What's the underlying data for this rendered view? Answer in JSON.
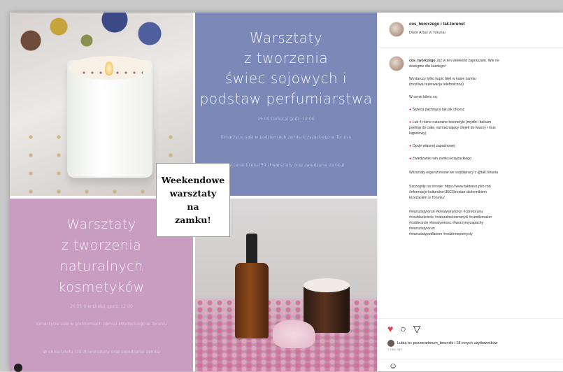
{
  "post": {
    "username": "cos_tworczego i tak.torunut",
    "location": "Dwór Artus w Toruniu",
    "caption_lines": [
      {
        "user": "cos_tworczego",
        "text": "Już w ten weekend zapraszam. Wie ne"
      },
      {
        "text": "dostępne dla każdego!"
      },
      {
        "text": "Wystarczy tylko kupić bilet w kasie zamku"
      },
      {
        "text": "(możliwa rezerwacja telefoniczna)"
      },
      {
        "text": "W cenie biletu są:"
      },
      {
        "bullet": true,
        "text": "Świeca pachnąca tak jak chcesz"
      },
      {
        "bullet": true,
        "text": "Lub 4 różne naturalne kosmetyki (mydło i balsam"
      },
      {
        "text": "peeling do ciała, wzmacniający olejek do twarzy i mus"
      },
      {
        "text": "kąpielowy)"
      },
      {
        "bullet": true,
        "text": "Opcje własnej zapachowej"
      },
      {
        "bullet": true,
        "text": "Zwiedzanie ruin zamku krzyżackiego"
      },
      {
        "text": "Warsztaty organizowane we współpracy z @tak.torunia"
      },
      {
        "text": "Szczegóły na stronie: https://www.taktorun.pl/o-rod"
      },
      {
        "text": "/informacje-kulturalne-35C3/zostan-alchemikiem"
      },
      {
        "text": "krzyżackim w Toruniu/"
      },
      {
        "text": "#warsztatytorun #kreatywnytorun #coretorunu"
      },
      {
        "text": "#cosblackcircle #naturalnekosmetyki #candlemaker"
      },
      {
        "text": "#coblecircle #kreatywnosc #tworzymyzapachy"
      },
      {
        "text": "#warsztatytorun"
      },
      {
        "text": "#warsztatypodlasem #rodzinnepomysly"
      }
    ],
    "liked_by": "Lubią to: pozzorariorum_torunski i 18 innych użytkowników",
    "date": "1 day ago"
  },
  "image": {
    "top_right": {
      "title_lines": [
        "Warsztaty",
        "z tworzenia",
        "świec sojowych i",
        "podstaw perfumiarstwa"
      ],
      "date": "25.05 (sobota) godz. 12:00",
      "place": "Kimarzycie sala w podziemiach zamku krzyżackiego w Toruniu",
      "price": "W cenie biletu (39 zł warsztaty oraz zwiedzanie zamku)"
    },
    "bottom_left": {
      "title_lines": [
        "Warsztaty",
        "z tworzenia",
        "naturalnych",
        "kosmetyków"
      ],
      "date": "26.05 (niedziela), godz. 12:00",
      "place": "Kimarzycie sala w podziemiach zamku krzyżackiego w Toruniu",
      "price": "W cenie biletu (39 zł) warsztaty oraz zwiedzanie zamku"
    },
    "badge_text": "Weekendowe\nwarsztaty\nna\nzamku!"
  },
  "icons": {
    "like": "heart-icon",
    "comment": "comment-icon",
    "share": "share-icon",
    "emoji": "smile-icon"
  },
  "colors": {
    "blue_panel": "#7b88b8",
    "pink_panel": "#c99cc1",
    "heart": "#ed3e4f"
  }
}
